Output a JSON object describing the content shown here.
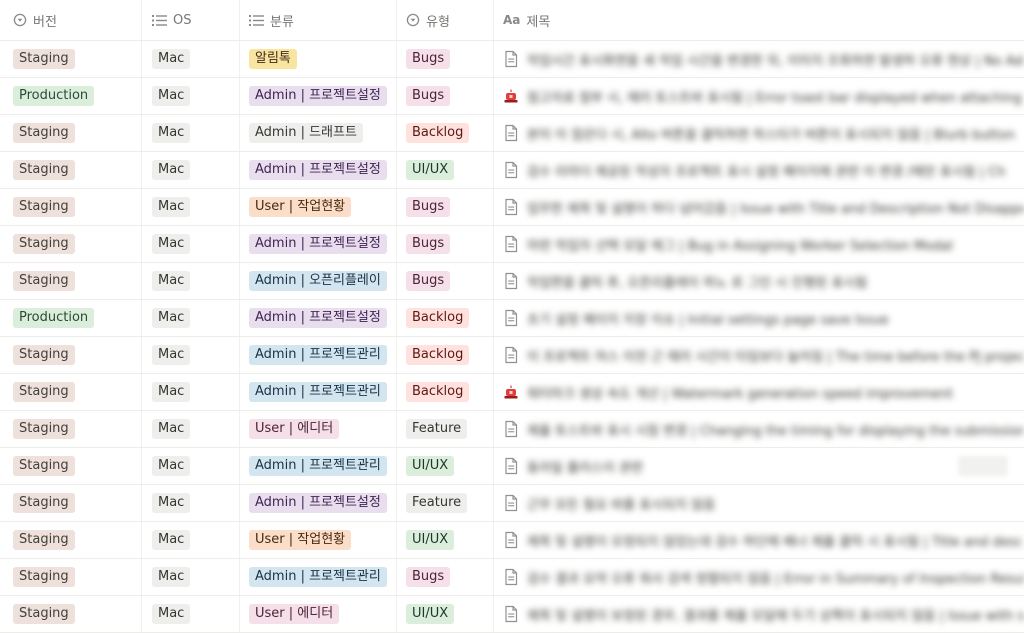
{
  "columns": {
    "version": "버전",
    "os": "OS",
    "category": "분류",
    "type": "유형",
    "title": "제목",
    "icons": [
      "select-icon",
      "list-icon",
      "list-icon",
      "select-icon",
      "text-aa-icon"
    ]
  },
  "rows": [
    {
      "version": "Staging",
      "os": "Mac",
      "category": "알림톡",
      "type": "Bugs",
      "icon": "page",
      "title": "작업시간 표시화면을 새 작업 시간을 변경한 뒤, 이미지 조회하면 발생하 오류 현상 | No Add"
    },
    {
      "version": "Production",
      "os": "Mac",
      "category": "Admin | 프로젝트설정",
      "type": "Bugs",
      "icon": "alert",
      "title": "첨고자료 첨부 시, 에러 토스트바 표시됨 | Error toast bar displayed when attaching re"
    },
    {
      "version": "Staging",
      "os": "Mac",
      "category": "Admin | 드래프트",
      "type": "Backlog",
      "icon": "page",
      "title": "본미 이 접은다 시, Alto 버튼을 클릭하면 하스타가 버튼이 표시되지 않음 | Blurb button"
    },
    {
      "version": "Staging",
      "os": "Mac",
      "category": "Admin | 프로젝트설정",
      "type": "UI/UX",
      "icon": "page",
      "title": "검수 리마더 제공된 작성자 프로젝트 표시 설정 페이지에 관련 이 변경 /에만 표시됨 | Ch"
    },
    {
      "version": "Staging",
      "os": "Mac",
      "category": "User | 작업현황",
      "type": "Bugs",
      "icon": "page",
      "title": "업무한 제목 및 설명이 하다 넘어갔음 | Issue with Title and Description Not Disappea"
    },
    {
      "version": "Staging",
      "os": "Mac",
      "category": "Admin | 프로젝트설정",
      "type": "Bugs",
      "icon": "page",
      "title": "마련 작업자 선택 모달 에그 | Bug in Assigning Worker Selection Modal"
    },
    {
      "version": "Staging",
      "os": "Mac",
      "category": "Admin | 오픈리플레이",
      "type": "Bugs",
      "icon": "page",
      "title": "작업편을 클릭 후, 오픈리플레이 하노 로 그인 시 진행된 표시됨"
    },
    {
      "version": "Production",
      "os": "Mac",
      "category": "Admin | 프로젝트설정",
      "type": "Backlog",
      "icon": "page",
      "title": "초기 설정 페이지 지장 이슈 | Initial settings page save Issue"
    },
    {
      "version": "Staging",
      "os": "Mac",
      "category": "Admin | 프로젝트관리",
      "type": "Backlog",
      "icon": "page",
      "title": "이 프로젝트 마스 이전 근 에러 시간이 타임보다 늘어짐 | The time before the PJ projec"
    },
    {
      "version": "Staging",
      "os": "Mac",
      "category": "Admin | 프로젝트관리",
      "type": "Backlog",
      "icon": "alert",
      "title": "워터마크 생성 속도 개선 | Watermark generation speed improvement"
    },
    {
      "version": "Staging",
      "os": "Mac",
      "category": "User | 에디터",
      "type": "Feature",
      "icon": "page",
      "title": "제출 토스트바 표시 시점 변경 | Changing the timing for displaying the submission t"
    },
    {
      "version": "Staging",
      "os": "Mac",
      "category": "Admin | 프로젝트관리",
      "type": "UI/UX",
      "icon": "page",
      "title": "동라일 플러스이 관련"
    },
    {
      "version": "Staging",
      "os": "Mac",
      "category": "Admin | 프로젝트설정",
      "type": "Feature",
      "icon": "page",
      "title": "근무 모든 필요 바를 표시되지 않음"
    },
    {
      "version": "Staging",
      "os": "Mac",
      "category": "User | 작업현황",
      "type": "UI/UX",
      "icon": "page",
      "title": "제목 및 설명이 모정되지 않았는데 검수 하단에 배너 제출 클릭 시 표시됨 | Title and desc"
    },
    {
      "version": "Staging",
      "os": "Mac",
      "category": "Admin | 프로젝트관리",
      "type": "Bugs",
      "icon": "page",
      "title": "검수 결과 요약 오류 워사 검색 정렬되지 않음 | Error in Summary of Inspection Result"
    },
    {
      "version": "Staging",
      "os": "Mac",
      "category": "User | 에디터",
      "type": "UI/UX",
      "icon": "page",
      "title": "제목 및 설명이 보정된 경우, 결과를 제출 모달에 두기 상쪽이 표시되지 않음 | Issue with s"
    }
  ],
  "colors": {
    "Staging": "t-staging",
    "Production": "t-production",
    "Mac": "t-mac",
    "알림톡": "t-yellow",
    "Admin | 프로젝트설정": "t-purple",
    "Admin | 드래프트": "t-gray",
    "User | 작업현황": "t-orange",
    "Admin | 오픈리플레이": "t-blue",
    "Admin | 프로젝트관리": "t-blue",
    "User | 에디터": "t-pink",
    "Bugs": "t-pink",
    "Backlog": "t-red",
    "UI/UX": "t-green",
    "Feature": "t-gray"
  }
}
